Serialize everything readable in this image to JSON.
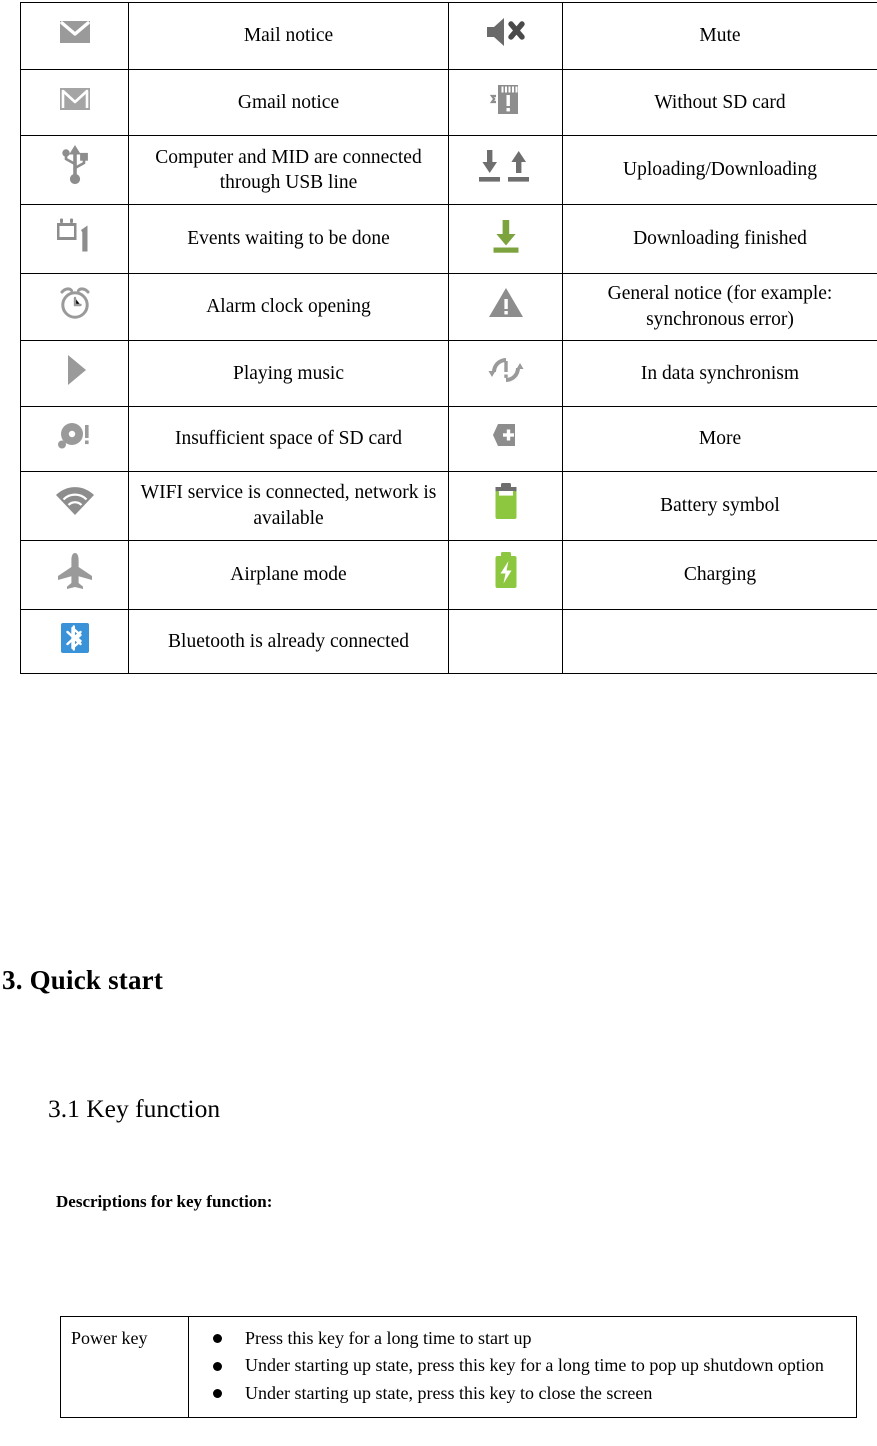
{
  "icon_table": {
    "rows": [
      {
        "icon_left": "mail-envelope-icon",
        "label_left": "Mail notice",
        "icon_right": "mute-speaker-icon",
        "label_right": "Mute"
      },
      {
        "icon_left": "gmail-icon",
        "label_left": "Gmail notice",
        "icon_right": "sd-card-missing-icon",
        "label_right": "Without SD card"
      },
      {
        "icon_left": "usb-icon",
        "label_left": "Computer and MID are connected through USB line",
        "icon_right": "upload-download-icon",
        "label_right": "Uploading/Downloading"
      },
      {
        "icon_left": "calendar-event-icon",
        "label_left": "Events waiting to be done",
        "icon_right": "download-finished-icon",
        "label_right": "Downloading finished"
      },
      {
        "icon_left": "alarm-clock-icon",
        "label_left": "Alarm clock opening",
        "icon_right": "warning-triangle-icon",
        "label_right": "General notice (for example: synchronous error)"
      },
      {
        "icon_left": "play-music-icon",
        "label_left": "Playing music",
        "icon_right": "sync-error-icon",
        "label_right": "In data synchronism"
      },
      {
        "icon_left": "sd-card-full-icon",
        "label_left": "Insufficient space of SD card",
        "icon_right": "more-plus-icon",
        "label_right": "More"
      },
      {
        "icon_left": "wifi-icon",
        "label_left": "WIFI service is connected, network is available",
        "icon_right": "battery-icon",
        "label_right": "Battery symbol"
      },
      {
        "icon_left": "airplane-mode-icon",
        "label_left": "Airplane mode",
        "icon_right": "battery-charging-icon",
        "label_right": "Charging"
      },
      {
        "icon_left": "bluetooth-icon",
        "label_left": "Bluetooth is already connected",
        "icon_right": "",
        "label_right": ""
      }
    ]
  },
  "headings": {
    "chapter": "3. Quick start",
    "section": "3.1 Key function",
    "subtitle": "Descriptions for key function:"
  },
  "key_table": {
    "rows": [
      {
        "key": "Power key",
        "items": [
          "Press this key for a long time to start up",
          "Under starting up state, press this key for a long time to pop up shutdown option",
          "Under starting up state, press this key to close the screen"
        ]
      }
    ]
  },
  "colors": {
    "icon_gray": "#8d8d8d",
    "icon_dark_gray": "#6e6e6e",
    "green": "#7da33f",
    "green_light": "#8dc63f",
    "blue": "#3a93d8"
  }
}
